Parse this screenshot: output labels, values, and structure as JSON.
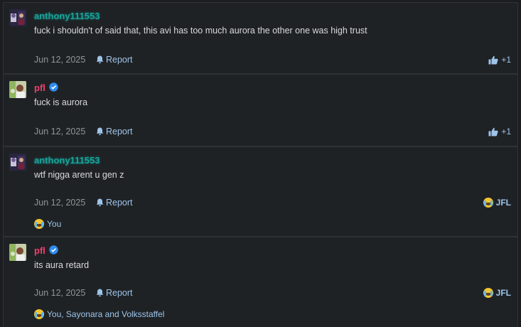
{
  "posts": [
    {
      "username": "anthony111553",
      "message": "fuck i shouldn't of said that, this avi has too much aurora the other one was high trust",
      "date": "Jun 12, 2025",
      "report_label": "Report",
      "reaction": {
        "icon": "thumbs-up-icon",
        "label": "+1"
      }
    },
    {
      "username": "pfl",
      "verified": true,
      "message": "fuck is aurora",
      "date": "Jun 12, 2025",
      "report_label": "Report",
      "reaction": {
        "icon": "thumbs-up-icon",
        "label": "+1"
      }
    },
    {
      "username": "anthony111553",
      "message": "wtf nigga arent u gen z",
      "date": "Jun 12, 2025",
      "report_label": "Report",
      "reaction": {
        "icon": "laughing-crying-emoji",
        "label": "JFL"
      },
      "reactors": "You"
    },
    {
      "username": "pfl",
      "verified": true,
      "message": "its aura retard",
      "date": "Jun 12, 2025",
      "report_label": "Report",
      "reaction": {
        "icon": "laughing-crying-emoji",
        "label": "JFL"
      },
      "reactors": "You, Sayonara and Volksstaffel"
    }
  ],
  "colors": {
    "background": "#1b1d20",
    "post_background": "#1f2225",
    "username_teal": "#1aa39a",
    "username_pink": "#f0406e",
    "link_blue": "#9ec4ea",
    "meta_gray": "#8f959b"
  }
}
